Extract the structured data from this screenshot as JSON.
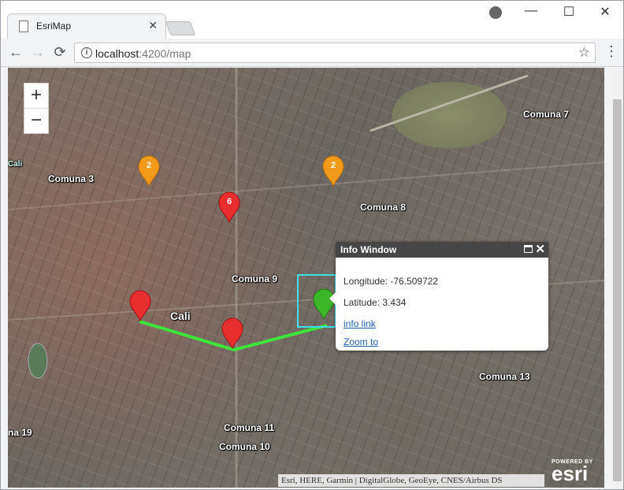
{
  "browser": {
    "tab_title": "EsriMap",
    "tab_close": "✕",
    "url_host": "localhost",
    "url_path": ":4200/map",
    "back": "←",
    "forward": "→",
    "reload": "⟳",
    "star": "☆",
    "menu": "⋮",
    "minimize": "—",
    "maximize": "☐",
    "close": "✕"
  },
  "map": {
    "zoom_in": "+",
    "zoom_out": "−",
    "labels": {
      "comuna3": "Comuna 3",
      "comuna7": "Comuna 7",
      "comuna8": "Comuna 8",
      "comuna9": "Comuna 9",
      "comuna10": "Comuna 10",
      "comuna11": "Comuna 11",
      "comuna13": "Comuna 13",
      "comuna19": "na 19",
      "cali": "Cali",
      "cali_small": "Cali"
    },
    "clusters": {
      "c1": "2",
      "c2": "2",
      "c3": "6"
    },
    "colors": {
      "cluster_orange": "#f39a1d",
      "marker_red": "#e82e2e",
      "marker_green": "#3cb52a",
      "route_green": "#3fe43a",
      "selection": "#3fe0e8"
    },
    "attribution": "Esri, HERE, Garmin | DigitalGlobe, GeoEye, CNES/Airbus DS",
    "esri_powered": "POWERED BY",
    "esri_word": "esri"
  },
  "popup": {
    "title": "Info Window",
    "longitude": "Longitude: -76.509722",
    "latitude": "Latitude: 3.434",
    "info_link": "info link",
    "zoom_to": "Zoom to"
  }
}
